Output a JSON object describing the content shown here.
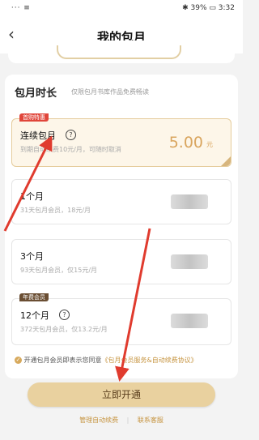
{
  "status_bar": {
    "left": " ··· ≡",
    "battery": "39%",
    "time": "3:32"
  },
  "nav": {
    "back_icon": "chevron-left-icon",
    "title": "我的包月"
  },
  "section": {
    "title": "包月时长",
    "subtitle": "仅限包月书库作品免费畅读"
  },
  "plans": [
    {
      "badge": "首购特惠",
      "name": "连续包月",
      "desc": "到期自动续费10元/月，可随时取消",
      "price": "5.00",
      "unit": "元"
    },
    {
      "name": "1个月",
      "desc": "31天包月会员，18元/月"
    },
    {
      "name": "3个月",
      "desc": "93天包月会员，仅15元/月"
    },
    {
      "badge": "年费会员",
      "name": "12个月",
      "desc": "372天包月会员，仅13.2元/月"
    }
  ],
  "agreement": {
    "prefix": "开通包月会员即表示您同意",
    "link": "《包月会员服务&自动续费协议》"
  },
  "cta": "立即开通",
  "footer": {
    "manage": "管理自动续费",
    "contact": "联系客服"
  },
  "colors": {
    "accent": "#d9a55e",
    "cta_bg": "#e9d19f",
    "annotation": "#e03b2e"
  }
}
